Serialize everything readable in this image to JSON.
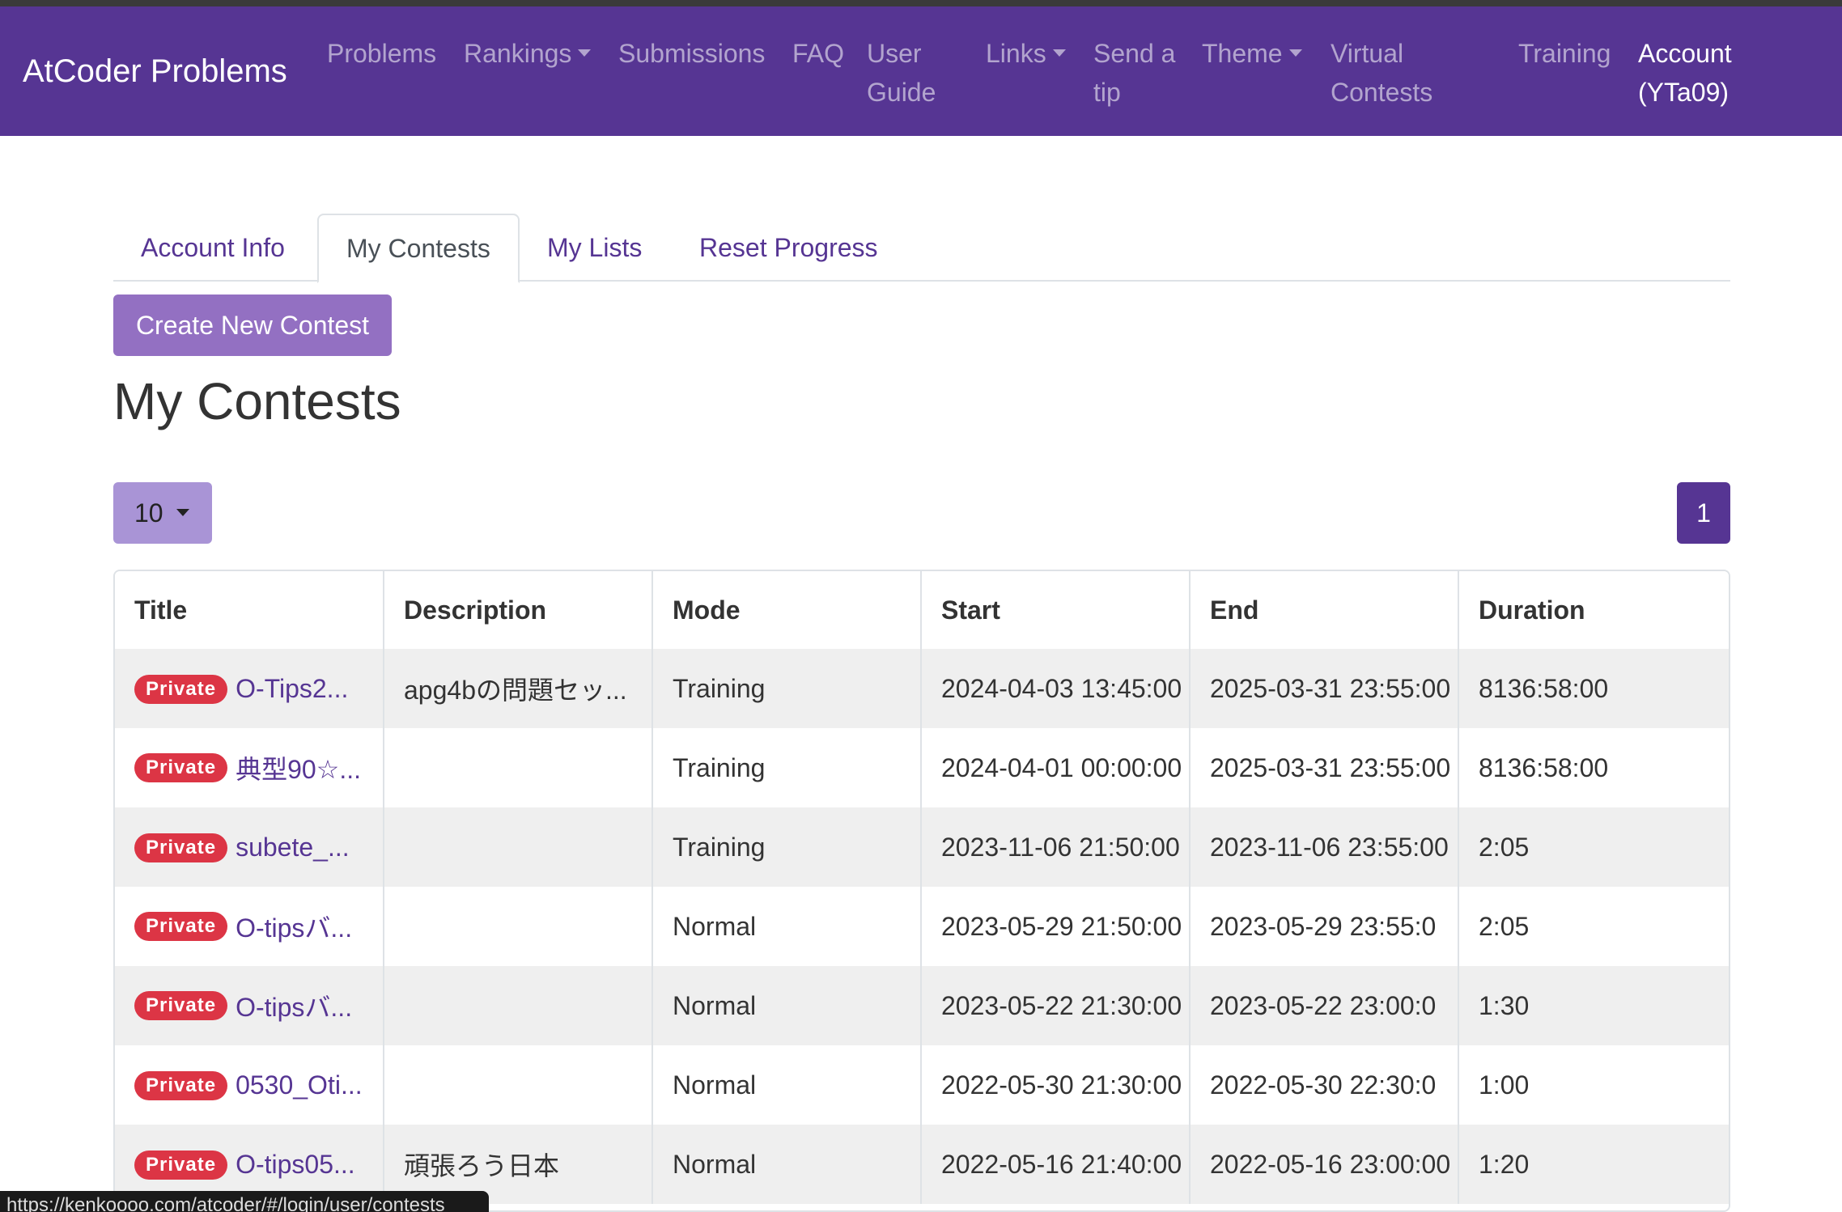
{
  "navbar": {
    "brand": "AtCoder Problems",
    "items": [
      {
        "label": "Problems"
      },
      {
        "label": "Rankings"
      },
      {
        "label": "Submissions"
      },
      {
        "label": "FAQ"
      },
      {
        "label_line1": "User",
        "label_line2": "Guide"
      },
      {
        "label": "Links"
      },
      {
        "label_line1": "Send a",
        "label_line2": "tip"
      },
      {
        "label": "Theme"
      },
      {
        "label_line1": "Virtual",
        "label_line2": "Contests"
      },
      {
        "label": "Training"
      },
      {
        "label_line1": "Account",
        "label_line2": "(YTa09)"
      }
    ]
  },
  "tabs": [
    {
      "label": "Account Info"
    },
    {
      "label": "My Contests"
    },
    {
      "label": "My Lists"
    },
    {
      "label": "Reset Progress"
    }
  ],
  "create_button": "Create New Contest",
  "page_title": "My Contests",
  "page_size": "10",
  "current_page": "1",
  "table": {
    "headers": [
      "Title",
      "Description",
      "Mode",
      "Start",
      "End",
      "Duration"
    ],
    "badge": "Private",
    "rows": [
      {
        "title": "O-Tips2...",
        "description": "apg4bの問題セッ...",
        "mode": "Training",
        "start": "2024-04-03 13:45:00",
        "end": "2025-03-31 23:55:00",
        "duration": "8136:58:00"
      },
      {
        "title": "典型90☆...",
        "description": "",
        "mode": "Training",
        "start": "2024-04-01 00:00:00",
        "end": "2025-03-31 23:55:00",
        "duration": "8136:58:00"
      },
      {
        "title": "subete_...",
        "description": "",
        "mode": "Training",
        "start": "2023-11-06 21:50:00",
        "end": "2023-11-06 23:55:00",
        "duration": "2:05"
      },
      {
        "title": "O-tipsバ...",
        "description": "",
        "mode": "Normal",
        "start": "2023-05-29 21:50:00",
        "end": "2023-05-29 23:55:0",
        "duration": "2:05"
      },
      {
        "title": "O-tipsバ...",
        "description": "",
        "mode": "Normal",
        "start": "2023-05-22 21:30:00",
        "end": "2023-05-22 23:00:0",
        "duration": "1:30"
      },
      {
        "title": "0530_Oti...",
        "description": "",
        "mode": "Normal",
        "start": "2022-05-30 21:30:00",
        "end": "2022-05-30 22:30:0",
        "duration": "1:00"
      },
      {
        "title": "O-tips05...",
        "description": "頑張ろう日本",
        "mode": "Normal",
        "start": "2022-05-16 21:40:00",
        "end": "2022-05-16 23:00:00",
        "duration": "1:20"
      }
    ]
  },
  "status_url": "https://kenkoooo.com/atcoder/#/login/user/contests"
}
